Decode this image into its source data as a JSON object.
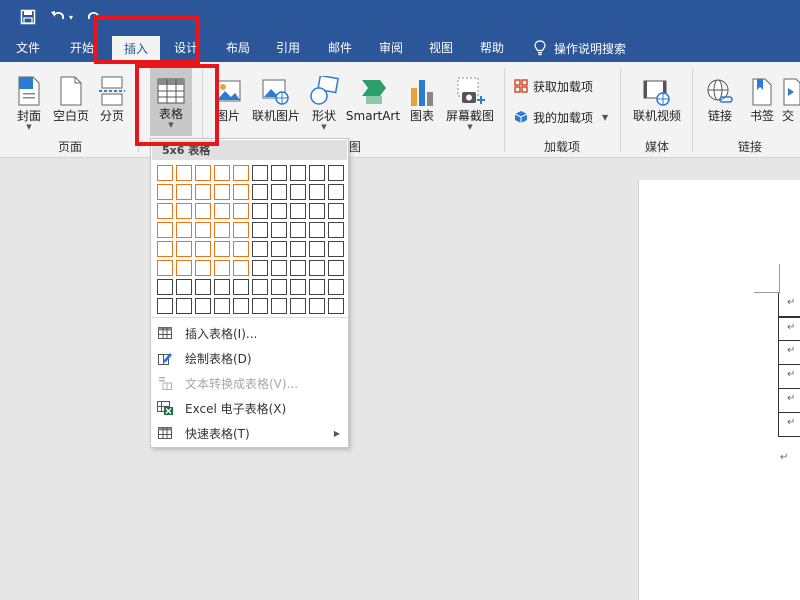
{
  "ribbon_tabs": [
    {
      "label": "文件"
    },
    {
      "label": "开始"
    },
    {
      "label": "插入"
    },
    {
      "label": "设计"
    },
    {
      "label": "布局"
    },
    {
      "label": "引用"
    },
    {
      "label": "邮件"
    },
    {
      "label": "审阅"
    },
    {
      "label": "视图"
    },
    {
      "label": "帮助"
    }
  ],
  "tell_me": "操作说明搜索",
  "ribbon": {
    "page_group": {
      "label": "页面",
      "cover": "封面",
      "blank": "空白页",
      "break": "分页"
    },
    "table_group": {
      "table": "表格"
    },
    "illustrations": {
      "picture": "图片",
      "online_picture": "联机图片",
      "shapes": "形状",
      "smartart": "SmartArt",
      "chart": "图表",
      "screenshot": "屏幕截图",
      "label_visible": "图"
    },
    "addins": {
      "label": "加载项",
      "get": "获取加载项",
      "mine": "我的加载项"
    },
    "media": {
      "label": "媒体",
      "online_video": "联机视频"
    },
    "links": {
      "label": "链接",
      "link": "链接",
      "bookmark": "书签",
      "cross": "交"
    }
  },
  "table_dropdown": {
    "header": "5x6 表格",
    "grid_cols": 10,
    "grid_rows": 8,
    "selected_cols": 5,
    "selected_rows": 6,
    "items": [
      {
        "label": "插入表格(I)...",
        "enabled": true
      },
      {
        "label": "绘制表格(D)",
        "enabled": true
      },
      {
        "label": "文本转换成表格(V)...",
        "enabled": false
      },
      {
        "label": "Excel 电子表格(X)",
        "enabled": true
      },
      {
        "label": "快速表格(T)",
        "enabled": true
      }
    ]
  },
  "doc": {
    "paragraph_mark": "↵"
  },
  "colors": {
    "title_bar": "#2b579a",
    "highlight": "#e8161a",
    "grid_selected": "#e8761c"
  }
}
